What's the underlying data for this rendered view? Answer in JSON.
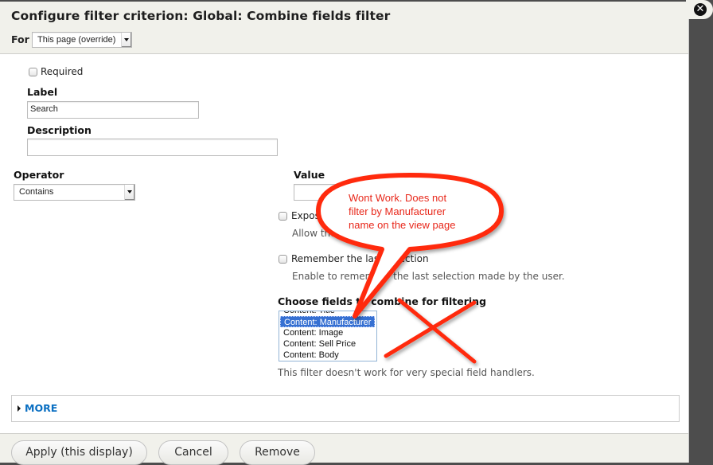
{
  "dialog": {
    "title": "Configure filter criterion: Global: Combine fields filter",
    "for_label": "For",
    "for_select_value": "This page (override)",
    "close_icon": "close-icon"
  },
  "form": {
    "required_label": "Required",
    "required_checked": false,
    "label_heading": "Label",
    "label_value": "Search",
    "description_heading": "Description",
    "description_value": "",
    "operator_heading": "Operator",
    "operator_value": "Contains",
    "value_heading": "Value",
    "value_input": "",
    "expose_label": "Expose",
    "expose_desc": "Allow the",
    "remember_label": "Remember the last selection",
    "remember_desc": "Enable to remember the last selection made by the user.",
    "fields_heading": "Choose fields to combine for filtering",
    "fields_options": [
      {
        "label": "Content: Title",
        "selected": false
      },
      {
        "label": "Content: Manufacturer",
        "selected": true
      },
      {
        "label": "Content: Image",
        "selected": false
      },
      {
        "label": "Content: Sell Price",
        "selected": false
      },
      {
        "label": "Content: Body",
        "selected": false
      }
    ],
    "fields_help": "This filter doesn't work for very special field handlers."
  },
  "more": {
    "label": "MORE"
  },
  "footer": {
    "apply_label": "Apply (this display)",
    "cancel_label": "Cancel",
    "remove_label": "Remove"
  },
  "annotation": {
    "callout_text_lines": [
      "Wont Work. Does not",
      "filter by Manufacturer",
      "name on the view page"
    ],
    "color": "#ff2a10"
  }
}
